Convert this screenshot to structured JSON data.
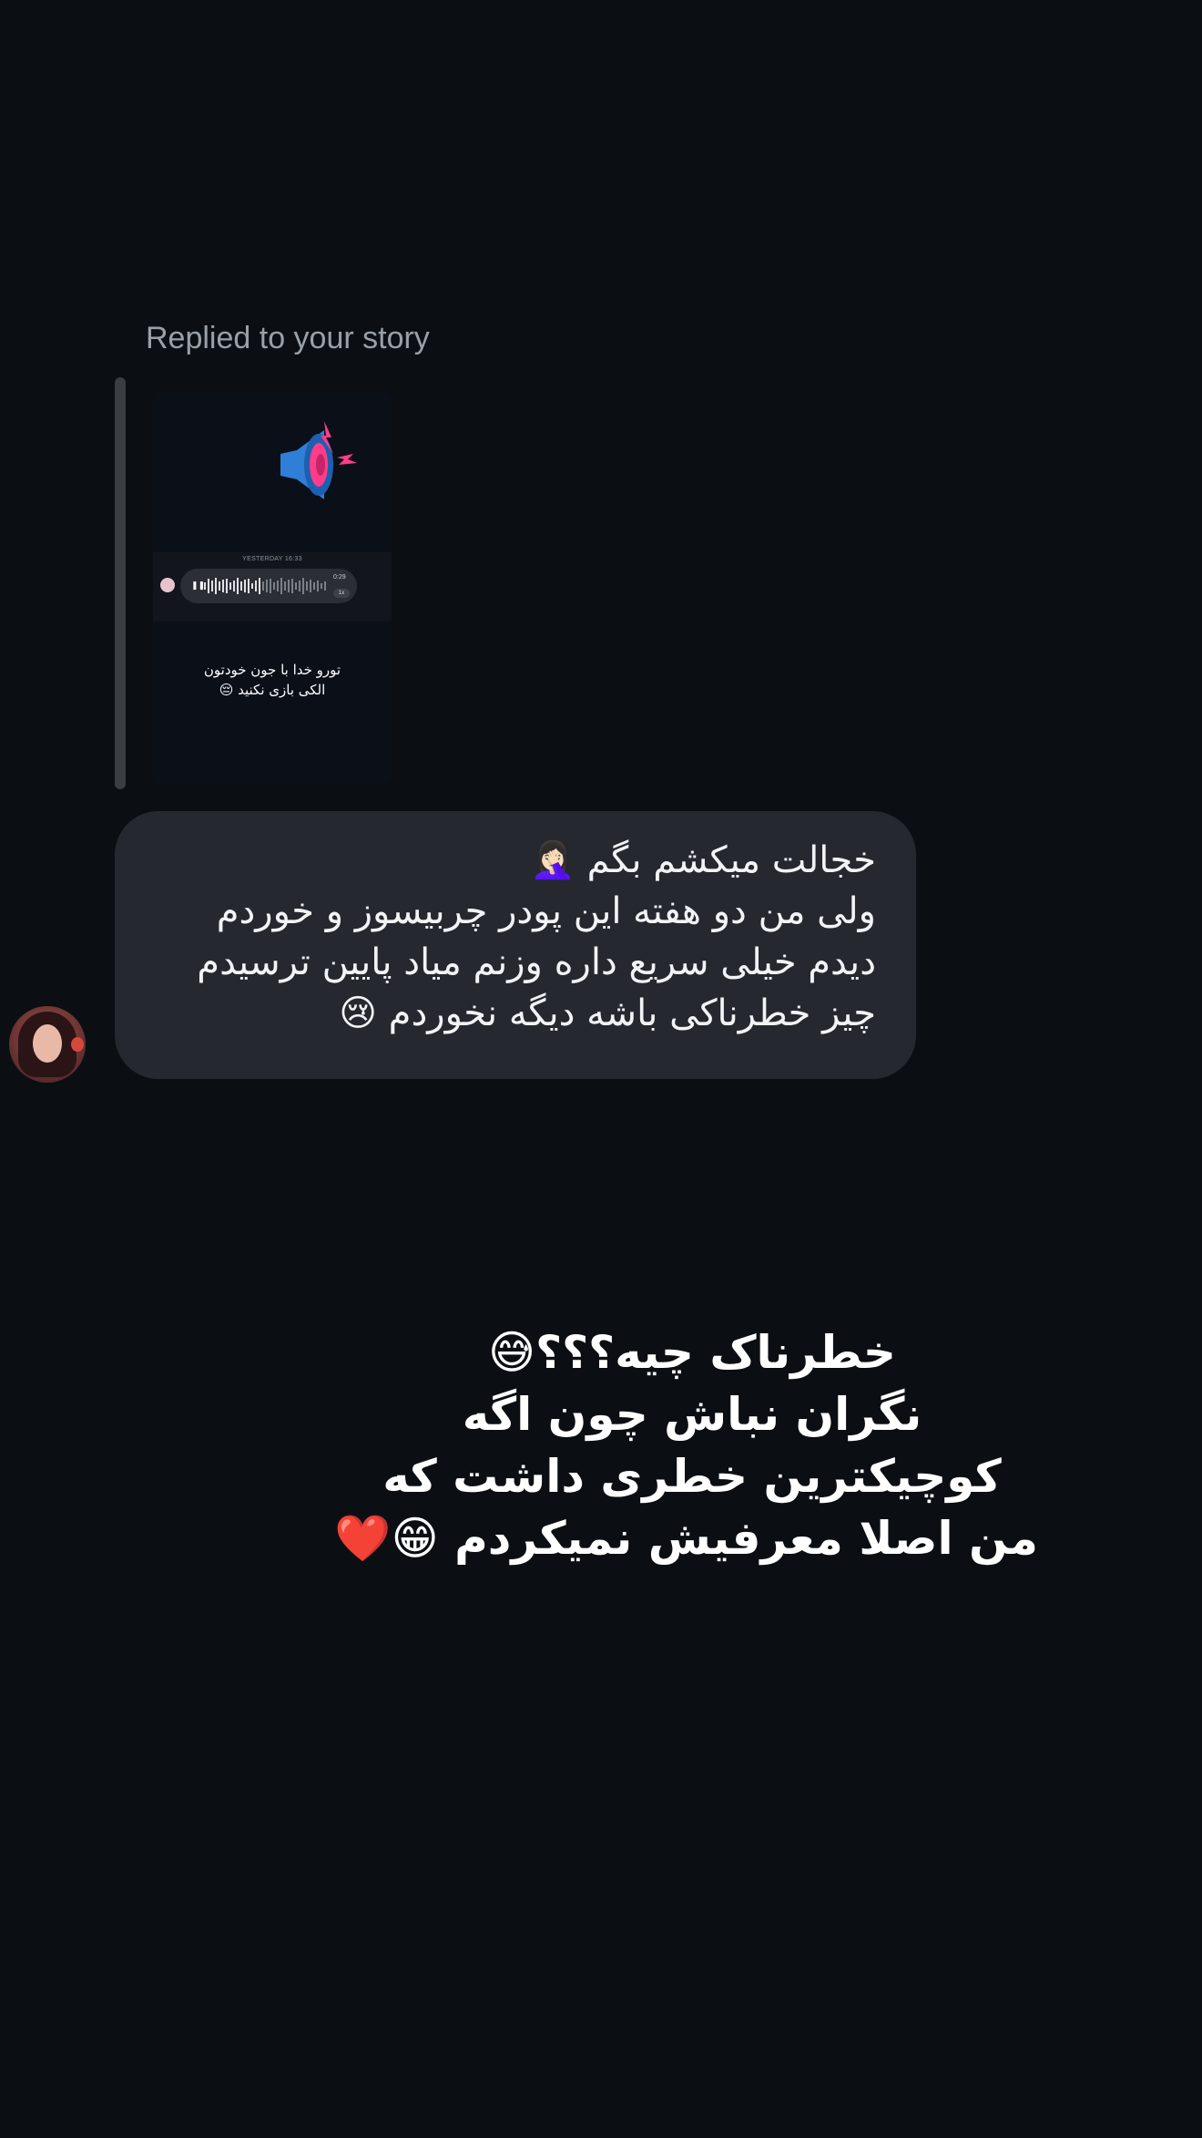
{
  "reply_header": {
    "label": "Replied to your story"
  },
  "story_preview": {
    "speaker_icon": "loudspeaker-icon",
    "timestamp": "YESTERDAY 16:33",
    "voice_duration": "0:29",
    "voice_speed": "1x",
    "caption_lines": [
      "تورو خدا با جون خودتون",
      "الکی بازی نکنید 😔"
    ]
  },
  "message": {
    "lines": [
      "خجالت میکشم بگم 🤦🏻‍♀️",
      "ولی من دو هفته این پودر چربیسوز و خوردم",
      "دیدم خیلی سریع داره وزنم میاد پایین ترسیدم",
      "چیز خطرناکی باشه دیگه نخوردم 😢"
    ]
  },
  "overlay": {
    "lines": [
      "خطرناک چیه؟؟؟😅",
      "نگران نباش چون اگه",
      "کوچیکترین خطری داشت که",
      "من اصلا معرفیش نمیکردم  😁❤️"
    ]
  },
  "colors": {
    "background": "#0b0f14",
    "bubble": "#25282e",
    "muted_text": "#9aa0a8",
    "speaker_blue": "#2f7fd8",
    "lightning_pink": "#ff3d8a"
  }
}
